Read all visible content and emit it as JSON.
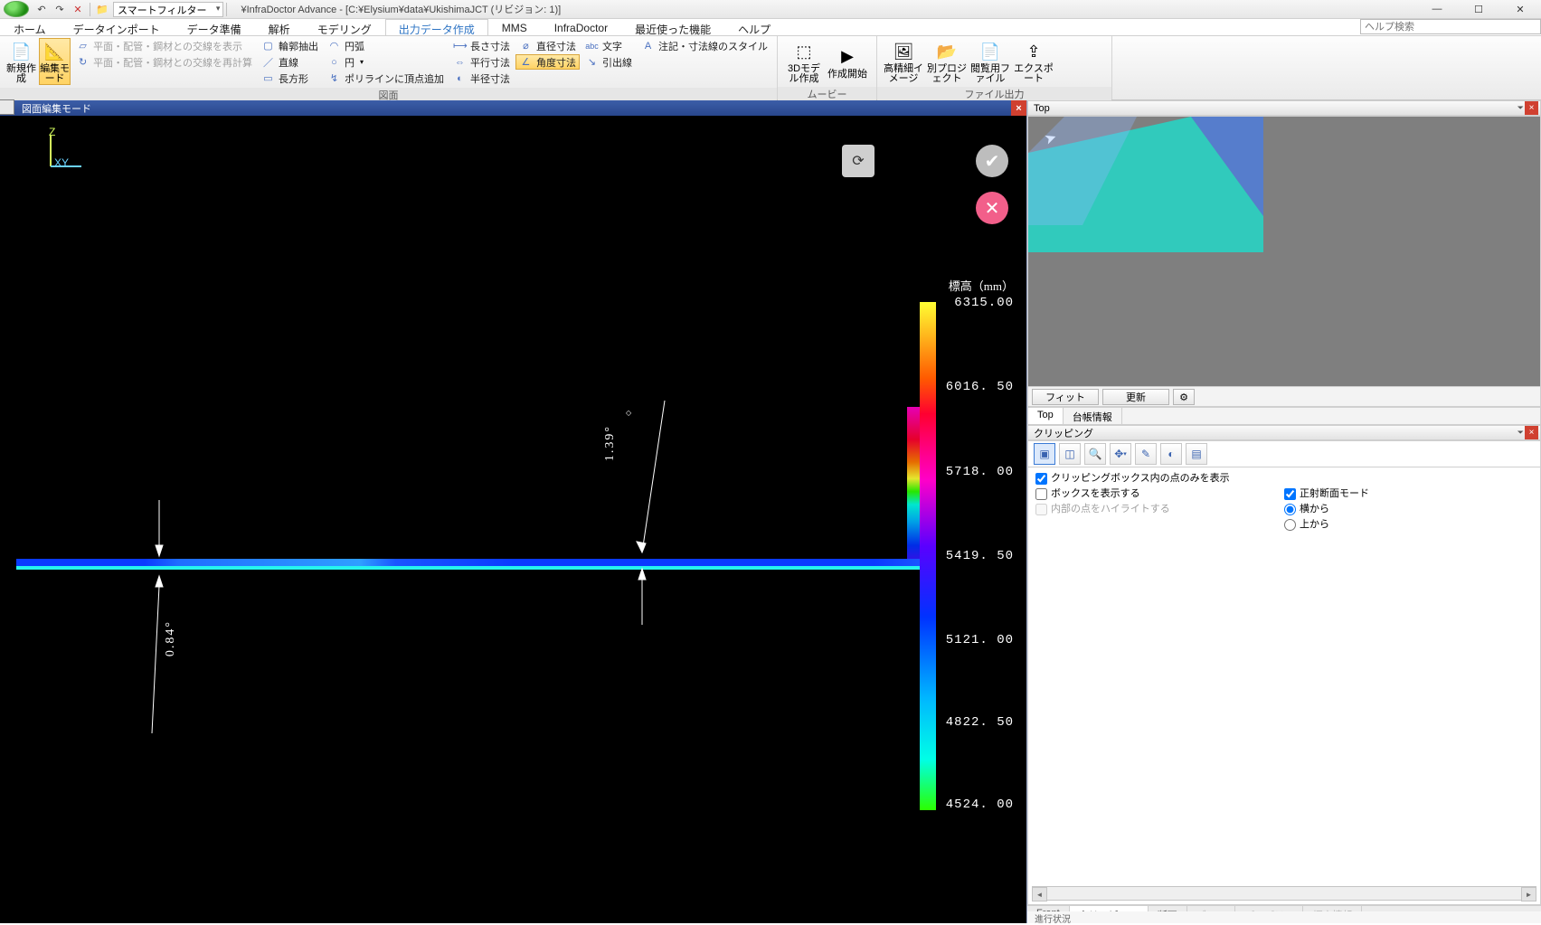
{
  "app_title": "¥InfraDoctor Advance - [C:¥Elysium¥data¥UkishimaJCT (リビジョン: 1)]",
  "smart_filter_label": "スマートフィルター",
  "help_search_placeholder": "ヘルプ検索",
  "tabs": {
    "home": "ホーム",
    "data_import": "データインポート",
    "data_prep": "データ準備",
    "analysis": "解析",
    "modeling": "モデリング",
    "output": "出力データ作成",
    "mms": "MMS",
    "infradoctor": "InfraDoctor",
    "recent": "最近使った機能",
    "help": "ヘルプ"
  },
  "ribbon": {
    "group_drawing": "図面",
    "group_movie": "ムービー",
    "group_file": "ファイル出力",
    "new": "新規作成",
    "edit_mode": "編集モード",
    "show_intersect": "平面・配管・鋼材との交線を表示",
    "recalc_intersect": "平面・配管・鋼材との交線を再計算",
    "contour": "輪郭抽出",
    "line": "直線",
    "rect": "長方形",
    "arc": "円弧",
    "circle": "円",
    "poly_vertex": "ポリラインに頂点追加",
    "len_dim": "長さ寸法",
    "par_dim": "平行寸法",
    "rad_dim": "半径寸法",
    "dia_dim": "直径寸法",
    "ang_dim": "角度寸法",
    "text": "文字",
    "leader": "引出線",
    "annot_style": "注記・寸法線のスタイル",
    "model3d": "3Dモデル作成",
    "start": "作成開始",
    "hires": "高精細イメージ",
    "proj": "別プロジェクト",
    "viewer": "閲覧用ファイル",
    "export": "エクスポート"
  },
  "viewport": {
    "title": "図面編集モード",
    "axis_z": "Z",
    "axis_xy": "XY",
    "dim1": "0.84°",
    "dim2": "1.39°",
    "colorbar_title": "標高（mm）",
    "colorbar_ticks": [
      "6315.00",
      "6016. 50",
      "5718. 00",
      "5419. 50",
      "5121. 00",
      "4822. 50",
      "4524. 00"
    ]
  },
  "right": {
    "top_title": "Top",
    "fit": "フィット",
    "update": "更新",
    "tabs_top": "Top",
    "tabs_ledger": "台帳情報",
    "clip_title": "クリッピング",
    "clip_only": "クリッピングボックス内の点のみを表示",
    "show_box": "ボックスを表示する",
    "ortho_mode": "正射断面モード",
    "highlight": "内部の点をハイライトする",
    "from_side": "横から",
    "from_top": "上から",
    "bottom_tabs": {
      "front": "Front",
      "clipping": "クリッピン…",
      "section": "断面",
      "zone": "ゾーン",
      "property": "プロパティ",
      "elev": "標高情報"
    }
  },
  "status": "進行状況"
}
